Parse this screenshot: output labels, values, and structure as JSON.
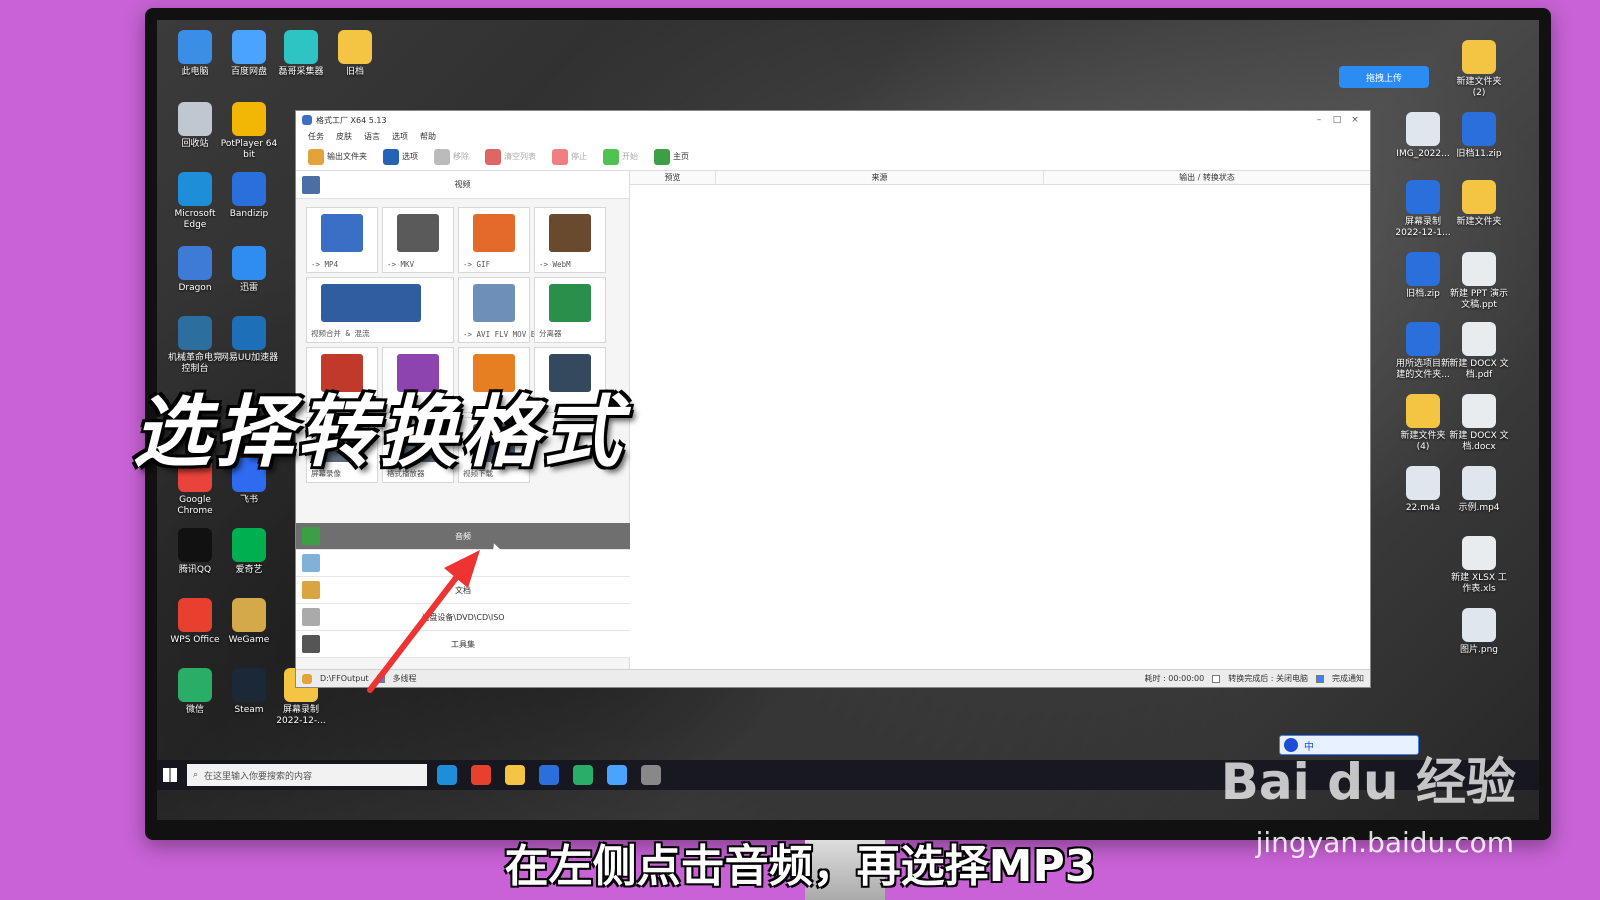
{
  "desktop": {
    "left_icons": [
      {
        "label": "此电脑",
        "icon": "computer-icon",
        "color": "#3a8ee6"
      },
      {
        "label": "百度网盘",
        "icon": "baidu-netdisk-icon",
        "color": "#4aa3ff"
      },
      {
        "label": "磊哥采集器",
        "icon": "collector-icon",
        "color": "#2ec4c4"
      },
      {
        "label": "旧档",
        "icon": "folder-icon",
        "color": "#f4c542"
      },
      {
        "label": "回收站",
        "icon": "recycle-bin-icon",
        "color": "#bfc7d1"
      },
      {
        "label": "PotPlayer 64 bit",
        "icon": "potplayer-icon",
        "color": "#f2b705"
      },
      {
        "label": "Microsoft Edge",
        "icon": "edge-icon",
        "color": "#1f8ed8"
      },
      {
        "label": "Bandizip",
        "icon": "bandizip-icon",
        "color": "#2a6fdb"
      },
      {
        "label": "Dragon",
        "icon": "dragon-icon",
        "color": "#3d7bd6"
      },
      {
        "label": "迅雷",
        "icon": "thunder-icon",
        "color": "#2f8cf0"
      },
      {
        "label": "机械革命电竞控制台",
        "icon": "mechrevo-icon",
        "color": "#2c6f9e"
      },
      {
        "label": "网易UU加速器",
        "icon": "uu-icon",
        "color": "#1d6fb8"
      },
      {
        "label": "Google Chrome",
        "icon": "chrome-icon",
        "color": "#e9433b"
      },
      {
        "label": "飞书",
        "icon": "feishu-icon",
        "color": "#2e6bf0"
      },
      {
        "label": "腾讯QQ",
        "icon": "qq-icon",
        "color": "#111111"
      },
      {
        "label": "爱奇艺",
        "icon": "iqiyi-icon",
        "color": "#00b050"
      },
      {
        "label": "WPS Office",
        "icon": "wps-icon",
        "color": "#e8402f"
      },
      {
        "label": "WeGame",
        "icon": "wegame-icon",
        "color": "#d3a94a"
      },
      {
        "label": "微信",
        "icon": "wechat-icon",
        "color": "#2aae67"
      },
      {
        "label": "Steam",
        "icon": "steam-icon",
        "color": "#1b2838"
      },
      {
        "label": "屏幕录制 2022-12-...",
        "icon": "folder-icon",
        "color": "#f4c542"
      }
    ],
    "right_icons": [
      {
        "label": "新建文件夹 (2)",
        "icon": "folder-icon",
        "color": "#f4c542"
      },
      {
        "label": "IMG_2022...",
        "icon": "phone-image-icon",
        "color": "#dfe6ee"
      },
      {
        "label": "旧档11.zip",
        "icon": "zip-icon",
        "color": "#2a6fdb"
      },
      {
        "label": "屏幕录制 2022-12-1...",
        "icon": "zip-icon",
        "color": "#2a6fdb"
      },
      {
        "label": "新建文件夹",
        "icon": "folder-icon",
        "color": "#f4c542"
      },
      {
        "label": "旧档.zip",
        "icon": "zip-icon",
        "color": "#2a6fdb"
      },
      {
        "label": "新建 PPT 演示文稿.ppt",
        "icon": "ppt-icon",
        "color": "#e8ecef"
      },
      {
        "label": "用所选项目新建的文件夹...",
        "icon": "zip-icon",
        "color": "#2a6fdb"
      },
      {
        "label": "新建 DOCX 文档.pdf",
        "icon": "pdf-icon",
        "color": "#e8ecef"
      },
      {
        "label": "新建文件夹 (4)",
        "icon": "folder-icon",
        "color": "#f4c542"
      },
      {
        "label": "新建 DOCX 文档.docx",
        "icon": "docx-icon",
        "color": "#e8ecef"
      },
      {
        "label": "22.m4a",
        "icon": "audio-file-icon",
        "color": "#dfe6ee"
      },
      {
        "label": "示例.mp4",
        "icon": "video-file-icon",
        "color": "#dfe6ee"
      },
      {
        "label": "新建 XLSX 工作表.xls",
        "icon": "xlsx-icon",
        "color": "#e8ecef"
      },
      {
        "label": "图片.png",
        "icon": "image-file-icon",
        "color": "#dfe6ee"
      }
    ],
    "upload_button": "拖拽上传",
    "ime_label": "中"
  },
  "window": {
    "title": "格式工厂 X64 5.13",
    "menu": [
      "任务",
      "皮肤",
      "语言",
      "选项",
      "帮助"
    ],
    "toolbar": [
      {
        "label": "输出文件夹",
        "color": "#e2a33b",
        "dim": false
      },
      {
        "label": "选项",
        "color": "#2463b5",
        "dim": false
      },
      {
        "label": "移除",
        "color": "#bbbbbb",
        "dim": true
      },
      {
        "label": "清空列表",
        "color": "#e06666",
        "dim": true
      },
      {
        "label": "停止",
        "color": "#f08080",
        "dim": true
      },
      {
        "label": "开始",
        "color": "#4fc24f",
        "dim": true
      },
      {
        "label": "主页",
        "color": "#3c9e45",
        "dim": false
      }
    ],
    "video_section": "视频",
    "tiles": [
      {
        "label": "-> MP4",
        "color": "#3b6fc6"
      },
      {
        "label": "-> MKV",
        "color": "#5a5a5a"
      },
      {
        "label": "-> GIF",
        "color": "#e36a2b"
      },
      {
        "label": "-> WebM",
        "color": "#6a4a2e"
      },
      {
        "label": "视频合并 & 混流",
        "color": "#2f5d9e"
      },
      {
        "label": "-> AVI FLV MOV Etc...",
        "color": "#6d8fb8"
      },
      {
        "label": "分离器",
        "color": "#2a8f4a"
      },
      {
        "label": "",
        "color": "#c0392b"
      },
      {
        "label": "",
        "color": "#8e44ad"
      },
      {
        "label": "",
        "color": "#e67e22"
      },
      {
        "label": "",
        "color": "#34495e"
      },
      {
        "label": "屏幕录像",
        "color": "#5d6d7e"
      },
      {
        "label": "格式播放器",
        "color": "#5d6d7e"
      },
      {
        "label": "视频下载",
        "color": "#5d6d7e"
      }
    ],
    "categories": [
      {
        "label": "音频",
        "active": true,
        "color": "#3c9e45"
      },
      {
        "label": "片",
        "active": false,
        "color": "#7fb1d9"
      },
      {
        "label": "文档",
        "active": false,
        "color": "#d9a441"
      },
      {
        "label": "光盘设备\\DVD\\CD\\ISO",
        "active": false,
        "color": "#aaaaaa"
      },
      {
        "label": "工具集",
        "active": false,
        "color": "#555555"
      }
    ],
    "columns": [
      "预览",
      "来源",
      "输出 / 转换状态"
    ],
    "status": {
      "output_path": "D:\\FFOutput",
      "multi_thread": "多线程",
      "elapsed": "耗时 : 00:00:00",
      "after_convert": "转换完成后 : 关闭电脑",
      "notify": "完成通知"
    }
  },
  "taskbar": {
    "search_placeholder": "在这里输入你要搜索的内容",
    "apps": [
      {
        "icon": "edge-icon",
        "color": "#1f8ed8"
      },
      {
        "icon": "wps-icon",
        "color": "#e8402f"
      },
      {
        "icon": "explorer-icon",
        "color": "#f4c542"
      },
      {
        "icon": "bandizip-icon",
        "color": "#2a6fdb"
      },
      {
        "icon": "wechat-icon",
        "color": "#2aae67"
      },
      {
        "icon": "baidu-netdisk-icon",
        "color": "#4aa3ff"
      },
      {
        "icon": "format-factory-icon",
        "color": "#888888"
      }
    ]
  },
  "overlay": {
    "headline": "选择转换格式",
    "subtitle": "在左侧点击音频，再选择MP3",
    "watermark": "Bai du 经验",
    "watermark_url": "jingyan.baidu.com"
  }
}
